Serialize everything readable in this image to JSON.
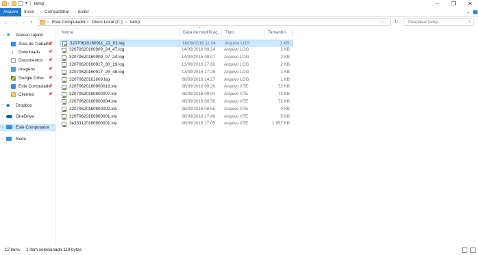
{
  "window": {
    "title": "temp",
    "controls": {
      "minimize": "–",
      "maximize": "❐",
      "close": "✕"
    }
  },
  "ribbon": {
    "tabs": [
      {
        "label": "Arquivo",
        "active": true
      },
      {
        "label": "Início"
      },
      {
        "label": "Compartilhar"
      },
      {
        "label": "Exibir"
      }
    ]
  },
  "address": {
    "breadcrumbs": [
      "Este Computador",
      "Disco Local (C:)",
      "temp"
    ],
    "search_placeholder": "Pesquisar temp"
  },
  "nav": {
    "items": [
      {
        "label": "Acesso rápido",
        "icon": "star-icon",
        "color": "#2b7cd3"
      },
      {
        "label": "Área de Trabalho",
        "icon": "desktop-icon",
        "color": "#3a8ee6",
        "pinned": true
      },
      {
        "label": "Downloads",
        "icon": "download-icon",
        "color": "#2b7cd3",
        "pinned": true
      },
      {
        "label": "Documentos",
        "icon": "documents-icon",
        "color": "#9aa4ad",
        "pinned": true
      },
      {
        "label": "Imagens",
        "icon": "pictures-icon",
        "color": "#4aa3df",
        "pinned": true
      },
      {
        "label": "Google Drive",
        "icon": "google-drive-icon",
        "color": "#f4b400",
        "pinned": true
      },
      {
        "label": "Este Computado",
        "icon": "computer-icon",
        "color": "#3a8ee6",
        "pinned": true
      },
      {
        "label": "Clientes",
        "icon": "folder-icon",
        "color": "#f3c969",
        "pinned": true
      },
      {
        "label": "Dropbox",
        "icon": "dropbox-icon",
        "color": "#0061fe"
      },
      {
        "label": "OneDrive",
        "icon": "onedrive-icon",
        "color": "#0a64ad"
      },
      {
        "label": "Este Computador",
        "icon": "computer-icon",
        "color": "#3a8ee6",
        "selected": true
      },
      {
        "label": "Rede",
        "icon": "network-icon",
        "color": "#3a8ee6"
      }
    ]
  },
  "columns": {
    "name": "Nome",
    "date": "Data de modificaç...",
    "type": "Tipo",
    "size": "Tamanho"
  },
  "files": [
    {
      "name": "32070620160911_22_03.log",
      "date": "16/09/2016 11:24",
      "type": "Arquivo LOG",
      "size": "1 KB",
      "selected": true
    },
    {
      "name": "32070620160909_24_47.log",
      "date": "14/09/2016 09:24",
      "type": "Arquivo LOG",
      "size": "2 KB"
    },
    {
      "name": "32070620160909_07_24.log",
      "date": "14/09/2016 09:07",
      "type": "Arquivo LOG",
      "size": "2 KB"
    },
    {
      "name": "32070620160917_30_19.log",
      "date": "13/09/2016 17:30",
      "type": "Arquivo LOG",
      "size": "2 KB"
    },
    {
      "name": "32070620160917_25_48.log",
      "date": "13/09/2016 17:25",
      "type": "Arquivo LOG",
      "size": "1 KB"
    },
    {
      "name": "32070620161609.log",
      "date": "08/09/2016 14:27",
      "type": "Arquivo LOG",
      "size": "1 KB"
    },
    {
      "name": "32070620160900019.xte",
      "date": "08/09/2016 09:26",
      "type": "Arquivo XTE",
      "size": "72 KB"
    },
    {
      "name": "32070620160900007.xte",
      "date": "08/09/2016 09:04",
      "type": "Arquivo XTE",
      "size": "72 KB"
    },
    {
      "name": "32070620160900004.xte",
      "date": "08/09/2016 08:56",
      "type": "Arquivo XTE",
      "size": "72 KB"
    },
    {
      "name": "32070620160900002.xte",
      "date": "08/09/2016 08:55",
      "type": "Arquivo XTE",
      "size": "0 KB"
    },
    {
      "name": "32070620160900001.xte",
      "date": "06/09/2016 17:49",
      "type": "Arquivo XTE",
      "size": "5 KB"
    },
    {
      "name": "34333120160900001.xte",
      "date": "06/09/2016 17:05",
      "type": "Arquivo XTE",
      "size": "1.957 KB"
    }
  ],
  "status": {
    "count": "12 itens",
    "selection": "1 item selecionado  119 bytes"
  }
}
